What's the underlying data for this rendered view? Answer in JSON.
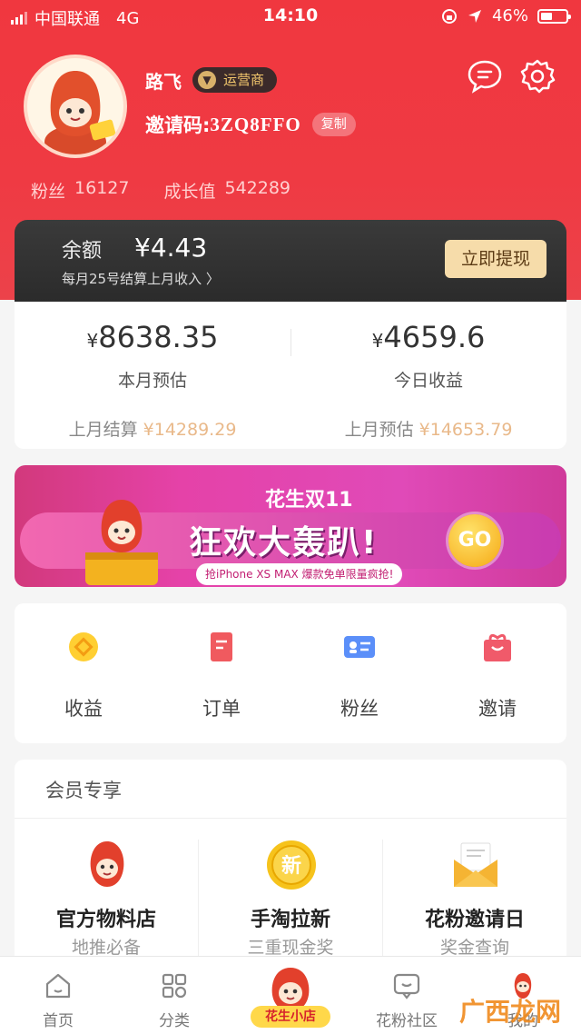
{
  "status_bar": {
    "carrier": "中国联通",
    "network": "4G",
    "time": "14:10",
    "battery": "46%"
  },
  "profile": {
    "username": "路飞",
    "role_badge": "运营商",
    "invite_label": "邀请码:",
    "invite_code": "3ZQ8FFO",
    "copy_label": "复制",
    "fans_label": "粉丝",
    "fans_value": "16127",
    "growth_label": "成长值",
    "growth_value": "542289"
  },
  "balance": {
    "label": "余额",
    "amount": "¥4.43",
    "note": "每月25号结算上月收入 〉",
    "withdraw_label": "立即提现"
  },
  "earnings": {
    "currency": "¥",
    "month_estimate_value": "8638.35",
    "month_estimate_label": "本月预估",
    "today_value": "4659.6",
    "today_label": "今日收益",
    "last_month_settled_label": "上月结算",
    "last_month_settled_value": "¥14289.29",
    "last_month_estimate_label": "上月预估",
    "last_month_estimate_value": "¥14653.79"
  },
  "banner": {
    "subtitle": "花生双11",
    "title": "狂欢大轰趴!",
    "tagline": "抢iPhone XS MAX  爆款免单限量疯抢!",
    "go_label": "GO"
  },
  "quick_menu": [
    {
      "label": "收益",
      "icon": "coin-icon"
    },
    {
      "label": "订单",
      "icon": "order-icon"
    },
    {
      "label": "粉丝",
      "icon": "fans-card-icon"
    },
    {
      "label": "邀请",
      "icon": "gift-icon"
    }
  ],
  "member": {
    "title": "会员专享",
    "items": [
      {
        "label": "官方物料店",
        "sub": "地推必备",
        "icon": "mascot-icon"
      },
      {
        "label": "手淘拉新",
        "sub": "三重现金奖",
        "icon": "new-badge-icon"
      },
      {
        "label": "花粉邀请日",
        "sub": "奖金查询",
        "icon": "envelope-icon"
      }
    ]
  },
  "tab_bar": {
    "items": [
      {
        "label": "首页",
        "icon": "home-icon"
      },
      {
        "label": "分类",
        "icon": "category-icon"
      },
      {
        "label": "花生小店",
        "icon": "shop-logo-icon"
      },
      {
        "label": "花粉社区",
        "icon": "community-icon"
      },
      {
        "label": "我的",
        "icon": "profile-icon"
      }
    ]
  },
  "watermark": "广西龙网",
  "colors": {
    "header_red": "#ef3a43",
    "balance_dark": "#2f2f2f",
    "withdraw_gold": "#f6dcaa",
    "accent_orange": "#e9b98a"
  }
}
